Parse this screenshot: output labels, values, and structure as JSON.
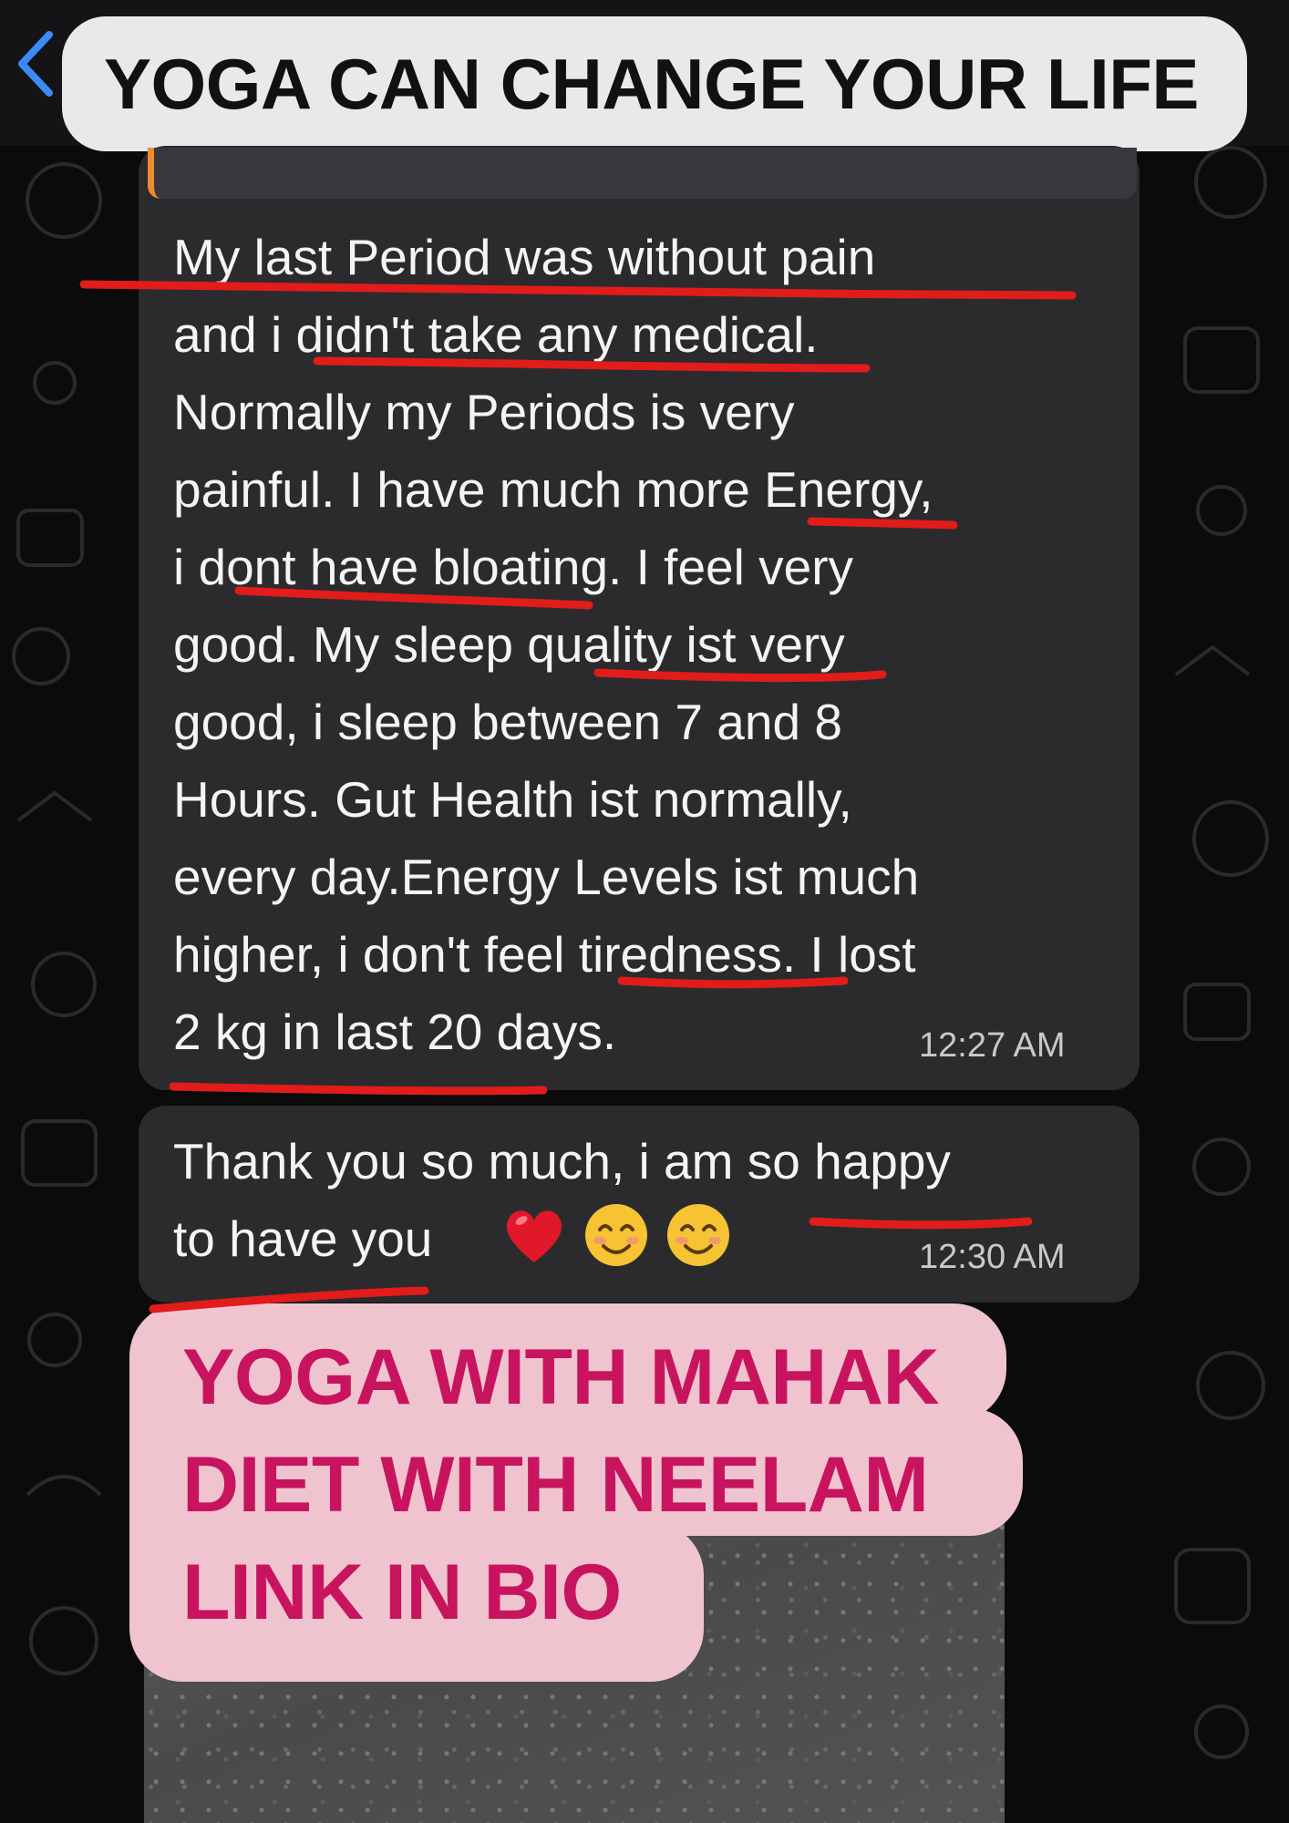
{
  "header": {
    "back_icon": "chevron-left-icon",
    "title": "YOGA CAN CHANGE YOUR LIFE"
  },
  "messages": [
    {
      "text": "My last Period was without pain\nand i didn't take any medical.\nNormally my Periods is very\npainful. I have much more Energy,\ni dont have bloating. I feel very\ngood. My sleep quality ist very\ngood, i sleep between 7 and 8\nHours. Gut Health ist normally,\nevery day.Energy Levels ist much\nhigher, i don't feel tiredness. I lost\n2 kg in last 20 days.",
      "time": "12:27 AM"
    },
    {
      "text": "Thank you so much, i am so happy\nto have you",
      "emojis": [
        "red-heart",
        "smiling-face",
        "smiling-face"
      ],
      "time": "12:30 AM"
    }
  ],
  "promo": {
    "text": "YOGA WITH MAHAK\nDIET WITH NEELAM\nLINK IN BIO"
  },
  "colors": {
    "bubble": "#2b2b2e",
    "title_pill": "#e9e9e9",
    "promo_bg": "#efc4cf",
    "promo_text": "#c8145f",
    "annotation_red": "#e21b1b",
    "quote_accent": "#f08a2e"
  }
}
